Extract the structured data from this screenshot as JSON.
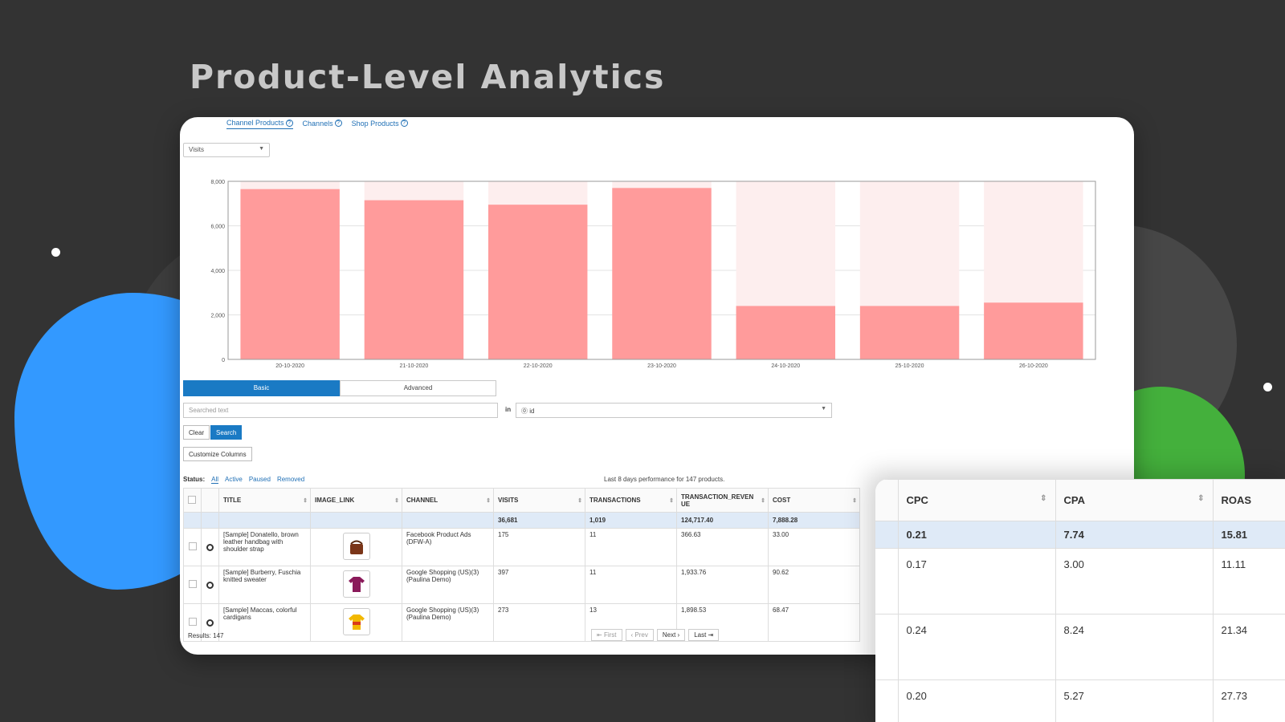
{
  "hero_title": "Product-Level Analytics",
  "tabs": [
    {
      "label": "Channel Products",
      "active": true
    },
    {
      "label": "Channels",
      "active": false
    },
    {
      "label": "Shop Products",
      "active": false
    }
  ],
  "metric_select": "Visits",
  "chart_data": {
    "type": "bar",
    "categories": [
      "20-10-2020",
      "21-10-2020",
      "22-10-2020",
      "23-10-2020",
      "24-10-2020",
      "25-10-2020",
      "26-10-2020"
    ],
    "values": [
      7650,
      7150,
      6950,
      7700,
      2400,
      2400,
      2550
    ],
    "ylim": [
      0,
      8000
    ],
    "yticks": [
      "0",
      "2,000",
      "4,000",
      "6,000",
      "8,000"
    ],
    "bar_color": "#ff9b9b",
    "bg_color": "#fdeeee"
  },
  "search": {
    "mode_basic": "Basic",
    "mode_advanced": "Advanced",
    "placeholder": "Searched text",
    "in_label": "in",
    "field": "id",
    "clear": "Clear",
    "search": "Search",
    "customize": "Customize Columns"
  },
  "status": {
    "label": "Status:",
    "options": [
      "All",
      "Active",
      "Paused",
      "Removed"
    ]
  },
  "perf_note": "Last 8 days performance for 147 products.",
  "table": {
    "headers": [
      "TITLE",
      "IMAGE_LINK",
      "CHANNEL",
      "VISITS",
      "TRANSACTIONS",
      "TRANSACTION_REVENUE",
      "COST"
    ],
    "totals": [
      "",
      "",
      "",
      "36,681",
      "1,019",
      "124,717.40",
      "7,888.28"
    ],
    "rows": [
      {
        "title": "[Sample] Donatello, brown leather handbag with shoulder strap",
        "channel": "Facebook Product Ads (DFW-A)",
        "visits": "175",
        "transactions": "11",
        "revenue": "366.63",
        "cost": "33.00"
      },
      {
        "title": "[Sample] Burberry, Fuschia knitted sweater",
        "channel": "Google Shopping (US)(3) (Paulina Demo)",
        "visits": "397",
        "transactions": "11",
        "revenue": "1,933.76",
        "cost": "90.62"
      },
      {
        "title": "[Sample] Maccas, colorful cardigans",
        "channel": "Google Shopping (US)(3) (Paulina Demo)",
        "visits": "273",
        "transactions": "13",
        "revenue": "1,898.53",
        "cost": "68.47"
      }
    ]
  },
  "results": "Results: 147",
  "pager": [
    "First",
    "Prev",
    "Next",
    "Last"
  ],
  "zoom": {
    "headers": [
      "CPC",
      "CPA",
      "ROAS"
    ],
    "totals": [
      "0.21",
      "7.74",
      "15.81"
    ],
    "rows": [
      [
        "0.17",
        "3.00",
        "11.11"
      ],
      [
        "0.24",
        "8.24",
        "21.34"
      ],
      [
        "0.20",
        "5.27",
        "27.73"
      ]
    ]
  }
}
